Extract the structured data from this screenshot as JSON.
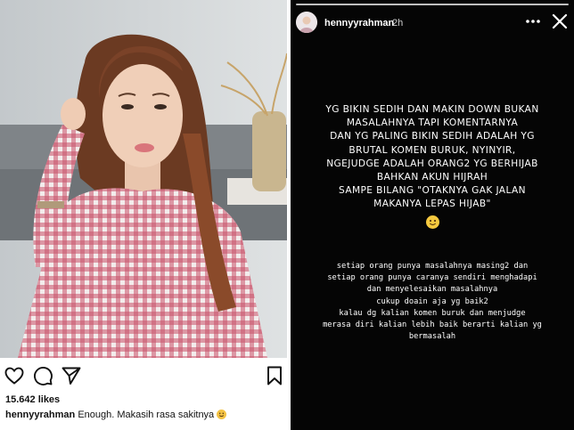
{
  "post": {
    "likes": "15.642 likes",
    "caption_user": "hennyyrahman",
    "caption_text": "Enough. Makasih rasa sakitnya"
  },
  "story": {
    "username": "hennyyrahman",
    "time": "2h",
    "main_lines": [
      "YG BIKIN SEDIH DAN MAKIN DOWN BUKAN",
      "MASALAHNYA TAPI KOMENTARNYA",
      "DAN YG PALING BIKIN SEDIH ADALAH YG",
      "BRUTAL KOMEN BURUK, NYINYIR,",
      "NGEJUDGE ADALAH ORANG2 YG BERHIJAB",
      "BAHKAN AKUN HIJRAH",
      "SAMPE BILANG \"OTAKNYA GAK JALAN",
      "MAKANYA LEPAS HIJAB\""
    ],
    "sub_lines": [
      "setiap orang punya masalahnya masing2 dan",
      "setiap orang punya caranya sendiri menghadapi",
      "dan menyelesaikan masalahnya",
      "cukup doain aja yg baik2",
      "kalau dg kalian komen buruk dan menjudge",
      "merasa diri kalian lebih baik berarti kalian yg",
      "bermasalah"
    ]
  },
  "icons": [
    "heart-icon",
    "comment-icon",
    "share-icon",
    "bookmark-icon",
    "more-icon",
    "close-icon",
    "smiley-emoji"
  ]
}
